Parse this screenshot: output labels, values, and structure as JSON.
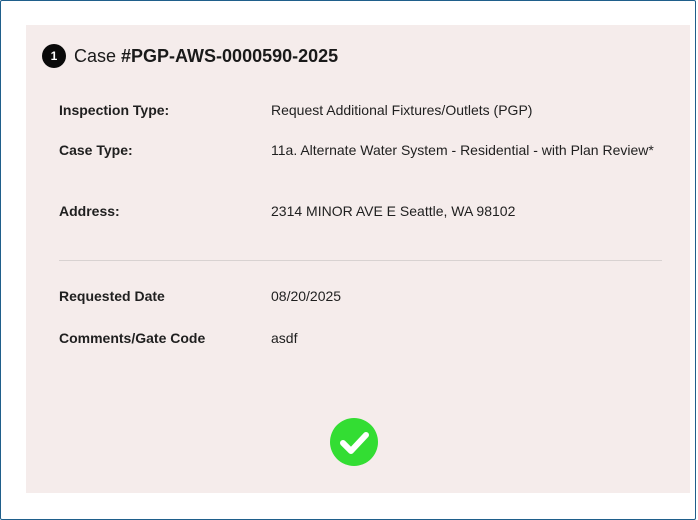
{
  "case": {
    "step_number": "1",
    "prefix": "Case",
    "number": "#PGP-AWS-0000590-2025"
  },
  "details": {
    "inspection_type_label": "Inspection Type:",
    "inspection_type_value": "Request Additional Fixtures/Outlets (PGP)",
    "case_type_label": "Case Type:",
    "case_type_value": "11a. Alternate Water System - Residential - with Plan Review*",
    "address_label": "Address:",
    "address_value": "2314 MINOR AVE E Seattle, WA 98102",
    "requested_date_label": "Requested Date",
    "requested_date_value": "08/20/2025",
    "comments_label": "Comments/Gate Code",
    "comments_value": "asdf"
  },
  "status": {
    "icon": "check-circle-icon",
    "color": "#33dd33"
  }
}
